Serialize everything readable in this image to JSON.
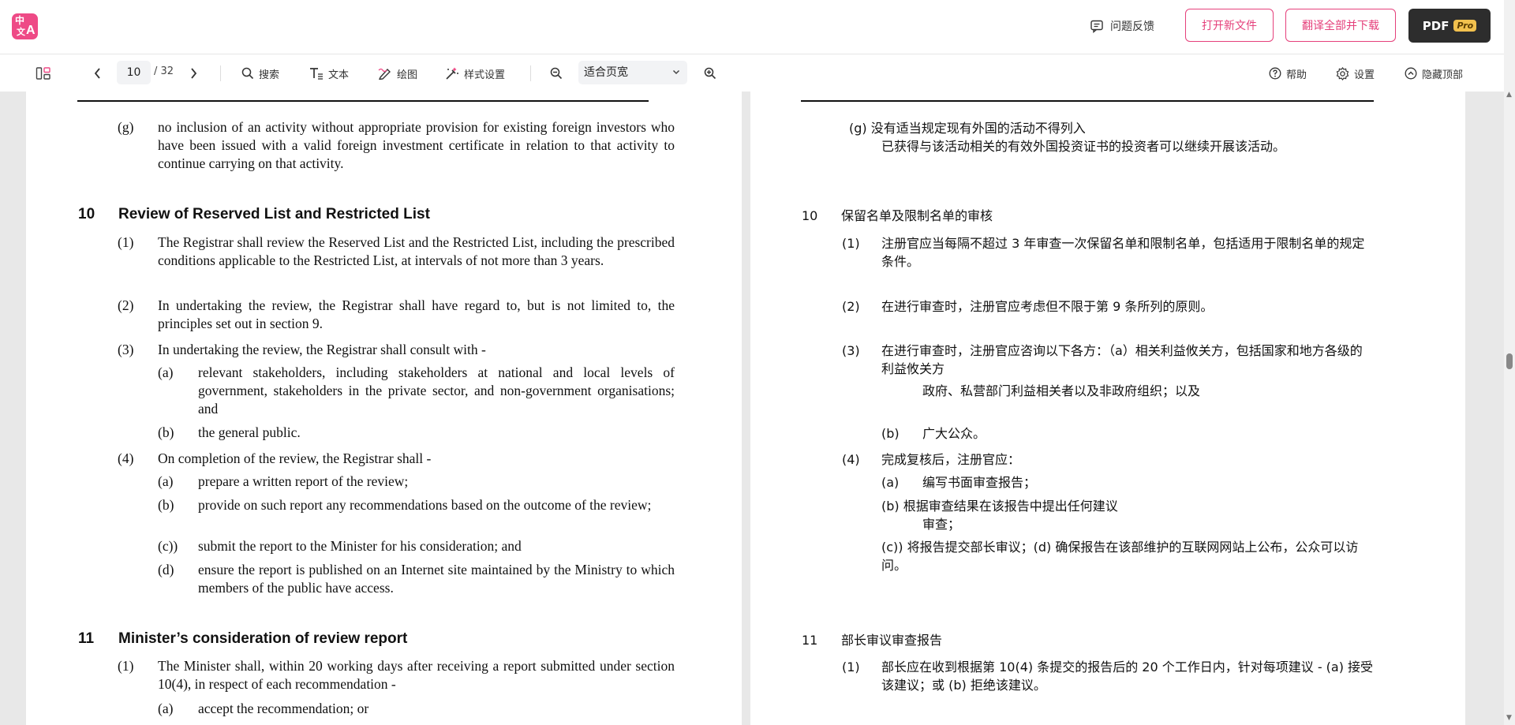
{
  "header": {
    "logo": {
      "top": "中",
      "bottom": "文",
      "letter": "A"
    },
    "feedback_label": "问题反馈",
    "open_file_label": "打开新文件",
    "translate_download_label": "翻译全部并下载",
    "pdf_label": "PDF",
    "pro_badge": "Pro"
  },
  "toolbar": {
    "current_page": "10",
    "total_pages": "/ 32",
    "search_label": "搜索",
    "text_label": "文本",
    "draw_label": "绘图",
    "style_label": "样式设置",
    "zoom_value": "适合页宽",
    "help_label": "帮助",
    "settings_label": "设置",
    "hide_top_label": "隐藏顶部"
  },
  "english": {
    "g_marker": "(g)",
    "g_text": "no inclusion of an activity without appropriate provision for existing foreign investors who have been issued with a valid foreign investment certificate in relation to that activity to continue carrying on that activity.",
    "s10": {
      "num": "10",
      "title": "Review of Reserved List and Restricted List",
      "p1": {
        "marker": "(1)",
        "text": "The Registrar shall review the Reserved List and the Restricted List, including the prescribed conditions applicable to the Restricted List, at intervals of not more than 3 years."
      },
      "p2": {
        "marker": "(2)",
        "text": "In undertaking the review, the Registrar shall have regard to, but is not limited to, the principles set out in section 9."
      },
      "p3": {
        "marker": "(3)",
        "text": "In undertaking the review, the Registrar shall consult with -",
        "a_marker": "(a)",
        "a_text": "relevant stakeholders, including stakeholders at national and local levels of government, stakeholders in the private sector, and non-government organisations; and",
        "b_marker": "(b)",
        "b_text": "the general public."
      },
      "p4": {
        "marker": "(4)",
        "text": "On completion of the review, the Registrar shall -",
        "a_marker": "(a)",
        "a_text": "prepare a written report of the review;",
        "b_marker": "(b)",
        "b_text": "provide on such report any recommendations based on the outcome of the review;",
        "c_marker": "(c))",
        "c_text": "submit the report to the Minister for his consideration; and",
        "d_marker": "(d)",
        "d_text": "ensure the report is published on an Internet site maintained by the Ministry to which members of the public have access."
      }
    },
    "s11": {
      "num": "11",
      "title": "Minister’s consideration of review report",
      "p1": {
        "marker": "(1)",
        "text": "The Minister shall, within 20 working days after receiving a report submitted under section 10(4), in respect of each recommendation -",
        "a_marker": "(a)",
        "a_text": "accept the recommendation; or"
      }
    }
  },
  "chinese": {
    "g_line1": "(g)  没有适当规定现有外国的活动不得列入",
    "g_line2": "已获得与该活动相关的有效外国投资证书的投资者可以继续开展该活动。",
    "s10": {
      "num": "10",
      "title": "保留名单及限制名单的审核",
      "p1": {
        "marker": "(1)",
        "text": "注册官应当每隔不超过 3 年审查一次保留名单和限制名单，包括适用于限制名单的规定条件。"
      },
      "p2": {
        "marker": "(2)",
        "text": "在进行审查时，注册官应考虑但不限于第 9 条所列的原则。"
      },
      "p3": {
        "marker": "(3)",
        "text": "在进行审查时，注册官应咨询以下各方：（a）相关利益攸关方，包括国家和地方各级的利益攸关方",
        "cont": "政府、私营部门利益相关者以及非政府组织；以及",
        "b_marker": "(b)",
        "b_text": "广大公众。"
      },
      "p4": {
        "marker": "(4)",
        "text": "完成复核后，注册官应：",
        "a_marker": "(a)",
        "a_text": "编写书面审查报告；",
        "b_text": "(b) 根据审查结果在该报告中提出任何建议",
        "b_cont": "审查；",
        "cd_text": "(c)) 将报告提交部长审议；(d) 确保报告在该部维护的互联网网站上公布，公众可以访问。"
      }
    },
    "s11": {
      "num": "11",
      "title": "部长审议审查报告",
      "p1": {
        "marker": "(1)",
        "text": "部长应在收到根据第 10(4) 条提交的报告后的 20 个工作日内，针对每项建议 - (a) 接受该建议；或 (b) 拒绝该建议。"
      }
    }
  }
}
